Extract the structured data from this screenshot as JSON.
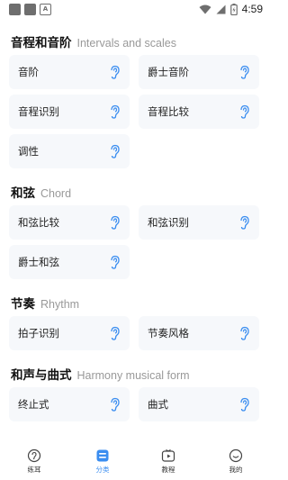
{
  "status_bar": {
    "time": "4:59",
    "icons": [
      "notification-square-icon",
      "notification-square-icon",
      "a-badge-icon",
      "wifi-icon",
      "signal-icon",
      "battery-icon"
    ]
  },
  "sections": [
    {
      "title_zh": "音程和音阶",
      "title_en": "Intervals and scales",
      "items": [
        "音阶",
        "爵士音阶",
        "音程识别",
        "音程比较",
        "调性"
      ]
    },
    {
      "title_zh": "和弦",
      "title_en": "Chord",
      "items": [
        "和弦比较",
        "和弦识别",
        "爵士和弦"
      ]
    },
    {
      "title_zh": "节奏",
      "title_en": "Rhythm",
      "items": [
        "拍子识别",
        "节奏风格"
      ]
    },
    {
      "title_zh": "和声与曲式",
      "title_en": "Harmony musical form",
      "items": [
        "终止式",
        "曲式"
      ]
    }
  ],
  "tabbar": {
    "active_color": "#3a8df0",
    "tabs": [
      {
        "label": "练耳",
        "icon": "ear-circle-icon"
      },
      {
        "label": "分类",
        "icon": "category-icon"
      },
      {
        "label": "教程",
        "icon": "tutorial-play-icon"
      },
      {
        "label": "我的",
        "icon": "profile-smile-icon"
      }
    ]
  },
  "accent_color": "#3a8df0",
  "card_color": "#f6f8fb"
}
